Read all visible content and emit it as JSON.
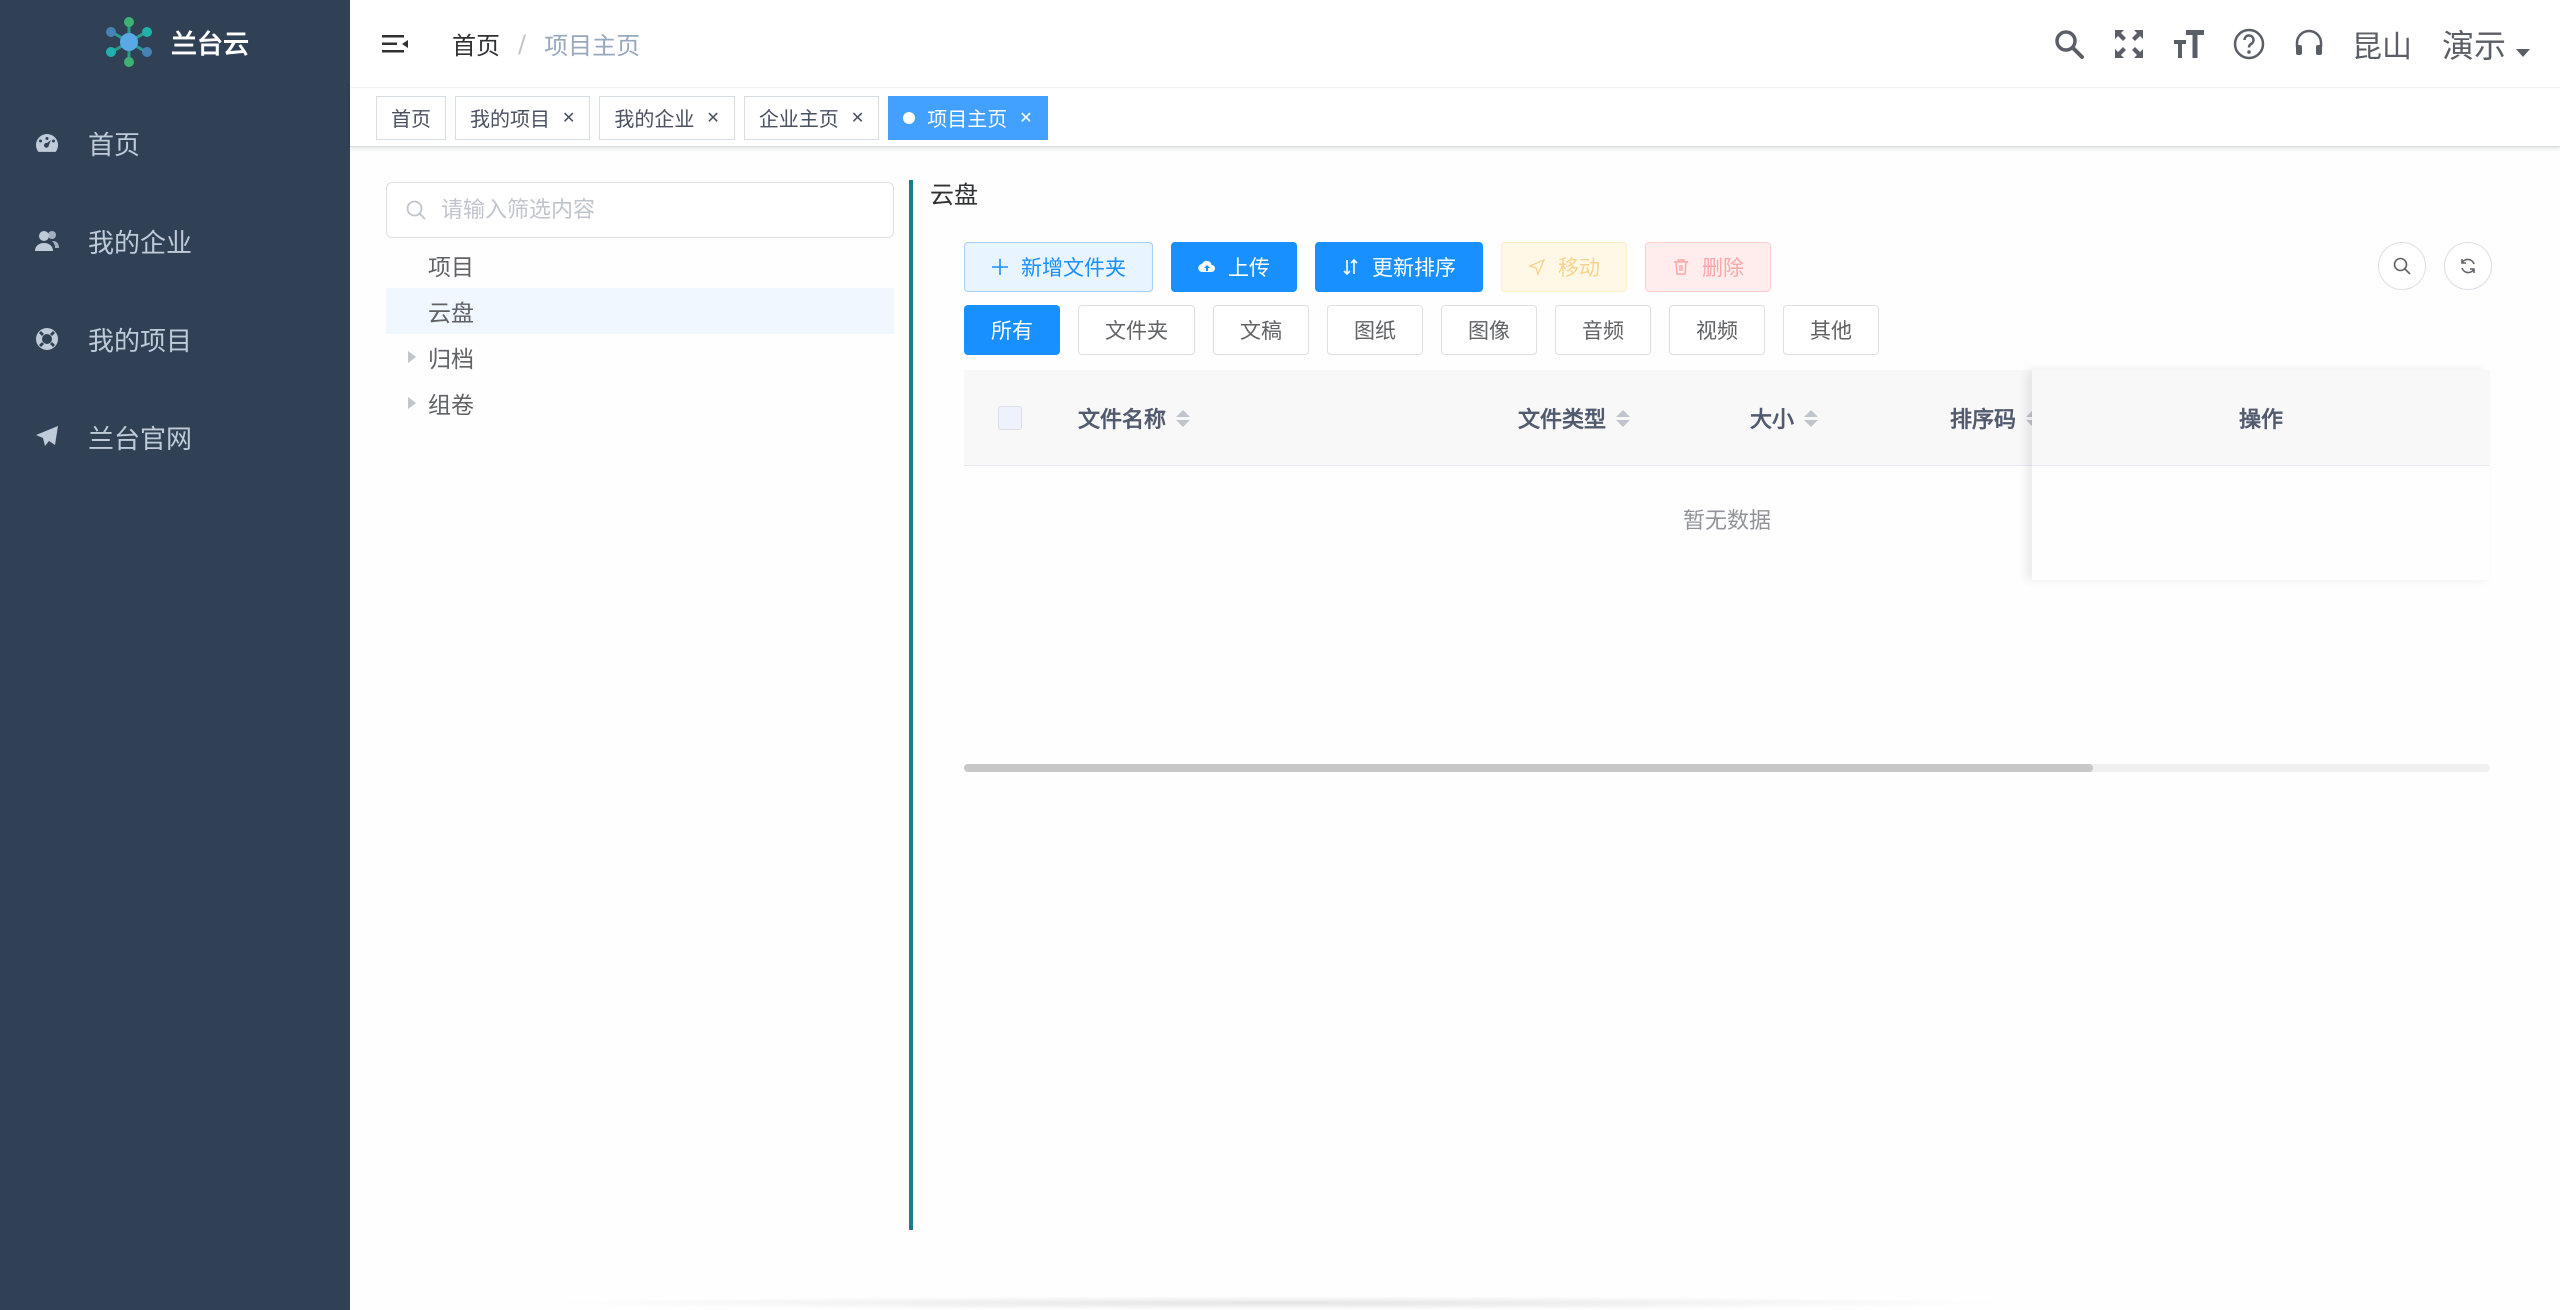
{
  "sidebar": {
    "brand_name": "兰台云",
    "logo_icon": "snowflake-logo",
    "items": [
      {
        "label": "首页",
        "icon": "dashboard-icon"
      },
      {
        "label": "我的企业",
        "icon": "peoples-icon"
      },
      {
        "label": "我的项目",
        "icon": "lifebuoy-icon"
      },
      {
        "label": "兰台官网",
        "icon": "paper-plane-icon"
      }
    ],
    "bg_color": "#304156"
  },
  "header": {
    "breadcrumb": {
      "home": "首页",
      "separator": "/",
      "current": "项目主页"
    },
    "size_icon_text": "T",
    "location": "昆山",
    "user": "演示"
  },
  "tags": [
    {
      "label": "首页",
      "closable": false,
      "active": false
    },
    {
      "label": "我的项目",
      "closable": true,
      "active": false
    },
    {
      "label": "我的企业",
      "closable": true,
      "active": false
    },
    {
      "label": "企业主页",
      "closable": true,
      "active": false
    },
    {
      "label": "项目主页",
      "closable": true,
      "active": true
    }
  ],
  "tree": {
    "filter_placeholder": "请输入筛选内容",
    "nodes": [
      {
        "label": "项目",
        "expandable": false,
        "selected": false
      },
      {
        "label": "云盘",
        "expandable": false,
        "selected": true
      },
      {
        "label": "归档",
        "expandable": true,
        "selected": false
      },
      {
        "label": "组卷",
        "expandable": true,
        "selected": false
      }
    ]
  },
  "main": {
    "title": "云盘",
    "toolbar": {
      "add_folder": "新增文件夹",
      "upload": "上传",
      "update_sort": "更新排序",
      "move": "移动",
      "delete": "删除"
    },
    "filters": [
      "所有",
      "文件夹",
      "文稿",
      "图纸",
      "图像",
      "音频",
      "视频",
      "其他"
    ],
    "active_filter": "所有",
    "table": {
      "columns": [
        "文件名称",
        "文件类型",
        "大小",
        "排序码"
      ],
      "fixed_column": "操作",
      "empty_text": "暂无数据",
      "scroll_fraction": 0.74
    }
  },
  "colors": {
    "primary": "#1890ff",
    "accent_divider": "#1d7c8b"
  }
}
